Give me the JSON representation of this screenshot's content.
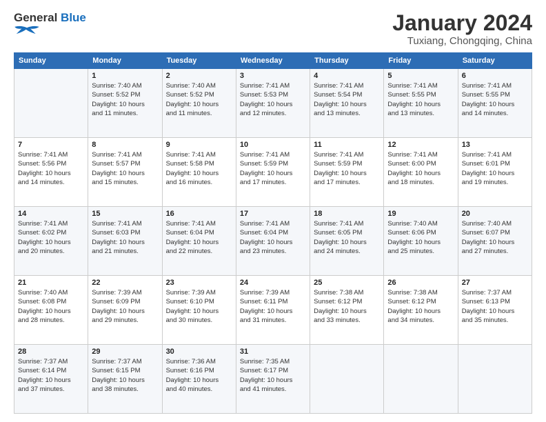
{
  "logo": {
    "line1": "General",
    "line2": "Blue",
    "icon_color": "#1a6fbd"
  },
  "title": "January 2024",
  "subtitle": "Tuxiang, Chongqing, China",
  "days_of_week": [
    "Sunday",
    "Monday",
    "Tuesday",
    "Wednesday",
    "Thursday",
    "Friday",
    "Saturday"
  ],
  "weeks": [
    [
      {
        "num": "",
        "info": ""
      },
      {
        "num": "1",
        "info": "Sunrise: 7:40 AM\nSunset: 5:52 PM\nDaylight: 10 hours\nand 11 minutes."
      },
      {
        "num": "2",
        "info": "Sunrise: 7:40 AM\nSunset: 5:52 PM\nDaylight: 10 hours\nand 11 minutes."
      },
      {
        "num": "3",
        "info": "Sunrise: 7:41 AM\nSunset: 5:53 PM\nDaylight: 10 hours\nand 12 minutes."
      },
      {
        "num": "4",
        "info": "Sunrise: 7:41 AM\nSunset: 5:54 PM\nDaylight: 10 hours\nand 13 minutes."
      },
      {
        "num": "5",
        "info": "Sunrise: 7:41 AM\nSunset: 5:55 PM\nDaylight: 10 hours\nand 13 minutes."
      },
      {
        "num": "6",
        "info": "Sunrise: 7:41 AM\nSunset: 5:55 PM\nDaylight: 10 hours\nand 14 minutes."
      }
    ],
    [
      {
        "num": "7",
        "info": "Sunrise: 7:41 AM\nSunset: 5:56 PM\nDaylight: 10 hours\nand 14 minutes."
      },
      {
        "num": "8",
        "info": "Sunrise: 7:41 AM\nSunset: 5:57 PM\nDaylight: 10 hours\nand 15 minutes."
      },
      {
        "num": "9",
        "info": "Sunrise: 7:41 AM\nSunset: 5:58 PM\nDaylight: 10 hours\nand 16 minutes."
      },
      {
        "num": "10",
        "info": "Sunrise: 7:41 AM\nSunset: 5:59 PM\nDaylight: 10 hours\nand 17 minutes."
      },
      {
        "num": "11",
        "info": "Sunrise: 7:41 AM\nSunset: 5:59 PM\nDaylight: 10 hours\nand 17 minutes."
      },
      {
        "num": "12",
        "info": "Sunrise: 7:41 AM\nSunset: 6:00 PM\nDaylight: 10 hours\nand 18 minutes."
      },
      {
        "num": "13",
        "info": "Sunrise: 7:41 AM\nSunset: 6:01 PM\nDaylight: 10 hours\nand 19 minutes."
      }
    ],
    [
      {
        "num": "14",
        "info": "Sunrise: 7:41 AM\nSunset: 6:02 PM\nDaylight: 10 hours\nand 20 minutes."
      },
      {
        "num": "15",
        "info": "Sunrise: 7:41 AM\nSunset: 6:03 PM\nDaylight: 10 hours\nand 21 minutes."
      },
      {
        "num": "16",
        "info": "Sunrise: 7:41 AM\nSunset: 6:04 PM\nDaylight: 10 hours\nand 22 minutes."
      },
      {
        "num": "17",
        "info": "Sunrise: 7:41 AM\nSunset: 6:04 PM\nDaylight: 10 hours\nand 23 minutes."
      },
      {
        "num": "18",
        "info": "Sunrise: 7:41 AM\nSunset: 6:05 PM\nDaylight: 10 hours\nand 24 minutes."
      },
      {
        "num": "19",
        "info": "Sunrise: 7:40 AM\nSunset: 6:06 PM\nDaylight: 10 hours\nand 25 minutes."
      },
      {
        "num": "20",
        "info": "Sunrise: 7:40 AM\nSunset: 6:07 PM\nDaylight: 10 hours\nand 27 minutes."
      }
    ],
    [
      {
        "num": "21",
        "info": "Sunrise: 7:40 AM\nSunset: 6:08 PM\nDaylight: 10 hours\nand 28 minutes."
      },
      {
        "num": "22",
        "info": "Sunrise: 7:39 AM\nSunset: 6:09 PM\nDaylight: 10 hours\nand 29 minutes."
      },
      {
        "num": "23",
        "info": "Sunrise: 7:39 AM\nSunset: 6:10 PM\nDaylight: 10 hours\nand 30 minutes."
      },
      {
        "num": "24",
        "info": "Sunrise: 7:39 AM\nSunset: 6:11 PM\nDaylight: 10 hours\nand 31 minutes."
      },
      {
        "num": "25",
        "info": "Sunrise: 7:38 AM\nSunset: 6:12 PM\nDaylight: 10 hours\nand 33 minutes."
      },
      {
        "num": "26",
        "info": "Sunrise: 7:38 AM\nSunset: 6:12 PM\nDaylight: 10 hours\nand 34 minutes."
      },
      {
        "num": "27",
        "info": "Sunrise: 7:37 AM\nSunset: 6:13 PM\nDaylight: 10 hours\nand 35 minutes."
      }
    ],
    [
      {
        "num": "28",
        "info": "Sunrise: 7:37 AM\nSunset: 6:14 PM\nDaylight: 10 hours\nand 37 minutes."
      },
      {
        "num": "29",
        "info": "Sunrise: 7:37 AM\nSunset: 6:15 PM\nDaylight: 10 hours\nand 38 minutes."
      },
      {
        "num": "30",
        "info": "Sunrise: 7:36 AM\nSunset: 6:16 PM\nDaylight: 10 hours\nand 40 minutes."
      },
      {
        "num": "31",
        "info": "Sunrise: 7:35 AM\nSunset: 6:17 PM\nDaylight: 10 hours\nand 41 minutes."
      },
      {
        "num": "",
        "info": ""
      },
      {
        "num": "",
        "info": ""
      },
      {
        "num": "",
        "info": ""
      }
    ]
  ]
}
